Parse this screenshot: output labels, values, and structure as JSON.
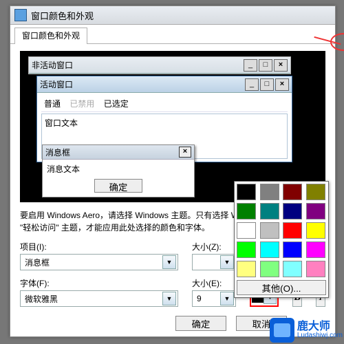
{
  "window": {
    "title": "窗口颜色和外观",
    "tab_label": "窗口颜色和外观"
  },
  "preview": {
    "inactive_title": "非活动窗口",
    "active_title": "活动窗口",
    "menu_normal": "普通",
    "menu_disabled": "已禁用",
    "menu_selected": "已选定",
    "window_text": "窗口文本",
    "msgbox_title": "消息框",
    "msgbox_text": "消息文本",
    "msgbox_ok": "确定"
  },
  "description": "要启用 Windows Aero，请选择 Windows 主题。只有选择 Windows 7 \"基本\" 主题或 \"轻松访问\" 主题，才能应用此处选择的颜色和字体。",
  "labels": {
    "item": "项目(I):",
    "size1": "大小(Z):",
    "font": "字体(F):",
    "size2": "大小(E):"
  },
  "values": {
    "item": "消息框",
    "size1": "",
    "font": "微软雅黑",
    "size2": "9",
    "color_swatch": "#000000",
    "bold": "B",
    "italic": "I"
  },
  "palette": {
    "other": "其他(O)...",
    "colors": [
      "#000000",
      "#808080",
      "#800000",
      "#808000",
      "#008000",
      "#008080",
      "#000080",
      "#800080",
      "#ffffff",
      "#c0c0c0",
      "#ff0000",
      "#ffff00",
      "#00ff00",
      "#00ffff",
      "#0000ff",
      "#ff00ff",
      "#ffff80",
      "#80ff80",
      "#80ffff",
      "#ff80c0"
    ]
  },
  "buttons": {
    "ok": "确定",
    "cancel": "取消"
  },
  "watermark": {
    "name": "鹿大师",
    "url": "Ludashiwj.com"
  }
}
